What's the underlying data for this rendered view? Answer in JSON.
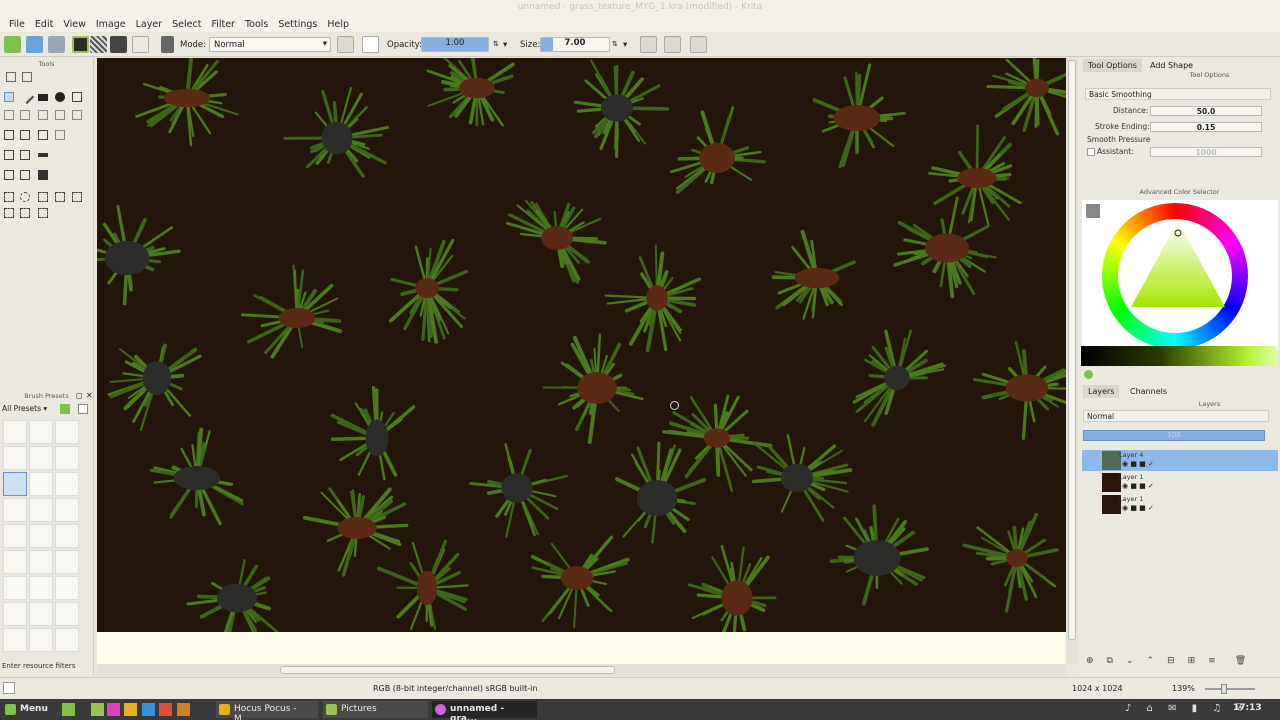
{
  "window": {
    "title": "unnamed - grass_texture_MYG_1.kra (modified) - Krita"
  },
  "menu": [
    "File",
    "Edit",
    "View",
    "Image",
    "Layer",
    "Select",
    "Filter",
    "Tools",
    "Settings",
    "Help"
  ],
  "toolbar": {
    "mode_label": "Mode:",
    "mode_value": "Normal",
    "opacity_label": "Opacity:",
    "opacity_value": "1.00",
    "opacity_fraction": 1.0,
    "size_label": "Size:",
    "size_value": "7.00"
  },
  "toolbox": {
    "title": "Tools"
  },
  "presets": {
    "title": "Brush Presets",
    "filter": "All Presets",
    "search_placeholder": "Enter resource filters"
  },
  "tool_options": {
    "tabs": [
      "Tool Options",
      "Add Shape"
    ],
    "header": "Tool Options",
    "smoothing": "Basic Smoothing",
    "distance_label": "Distance:",
    "distance_value": "50.0",
    "stroke_ending_label": "Stroke Ending:",
    "stroke_ending_value": "0.15",
    "smooth_pressure_label": "Smooth Pressure",
    "assistant_label": "Assistant:",
    "assistant_value": "1000"
  },
  "color_selector": {
    "title": "Advanced Color Selector",
    "selected_color": "#c7f34f"
  },
  "layers": {
    "tabs": [
      "Layers",
      "Channels"
    ],
    "header": "Layers",
    "blend_mode": "Normal",
    "opacity": "100",
    "items": [
      {
        "name": "Layer 4"
      },
      {
        "name": "Layer 1"
      },
      {
        "name": "Layer 1"
      }
    ]
  },
  "status": {
    "color_profile": "RGB (8-bit integer/channel)  sRGB built-in",
    "image_size": "1024 x 1024",
    "zoom": "139%"
  },
  "taskbar": {
    "menu_label": "Menu",
    "tasks": [
      "Hocus Pocus - M...",
      "Pictures",
      "unnamed - gra..."
    ],
    "clock": "17:13"
  },
  "colors": {
    "canvas_bg": "#231509",
    "grass": "#3c6518",
    "accent": "#86afe0"
  }
}
